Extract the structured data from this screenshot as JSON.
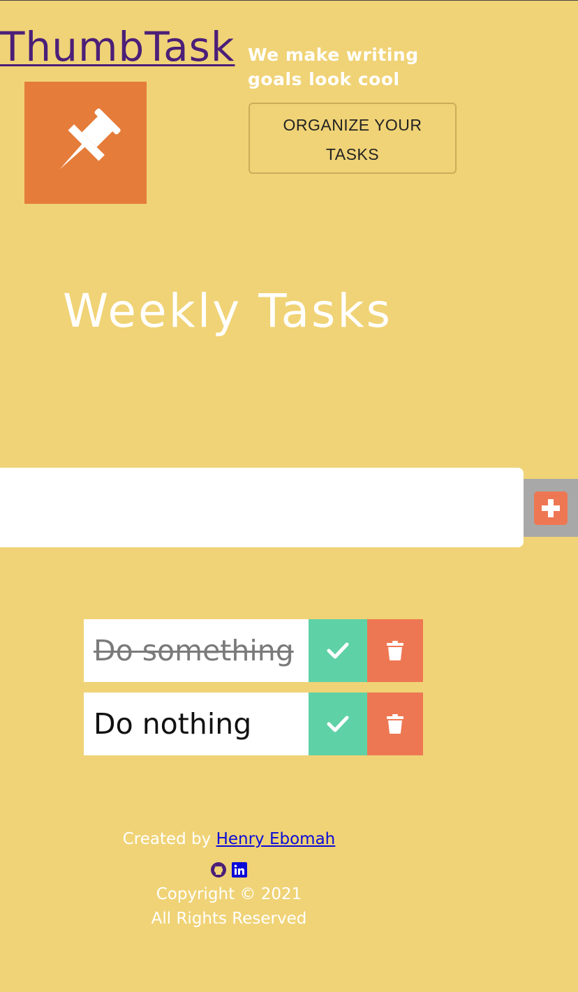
{
  "header": {
    "logo_text": "ThumbTask",
    "logo_icon": "pushpin-icon",
    "tagline": "We make writing goals look cool",
    "cta_label": "ORGANIZE YOUR TASKS"
  },
  "main": {
    "title": "Weekly Tasks",
    "input": {
      "value": "",
      "placeholder": ""
    },
    "add_icon": "plus-square-icon",
    "todos": [
      {
        "text": "Do something",
        "completed": true
      },
      {
        "text": "Do nothing",
        "completed": false
      }
    ]
  },
  "footer": {
    "created_prefix": "Created by",
    "author": "Henry Ebomah",
    "icons": [
      "github-icon",
      "linkedin-icon"
    ],
    "copyright": "Copyright © 2021",
    "rights": "All Rights Reserved"
  },
  "colors": {
    "background": "#f0d376",
    "logo_text": "#4b1f78",
    "logo_box": "#e57c3a",
    "accent_orange": "#ee7753",
    "check_green": "#5fd1a6",
    "add_button_bg": "#a8a8a8",
    "link_blue": "#0a0ad8"
  }
}
